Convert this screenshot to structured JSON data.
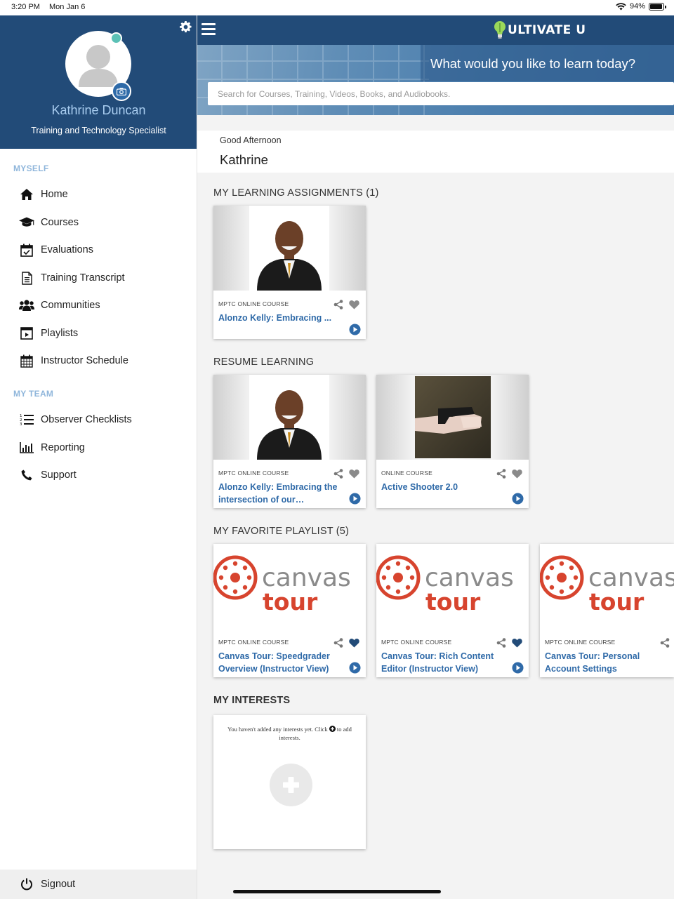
{
  "status_bar": {
    "time": "3:20 PM",
    "date": "Mon Jan 6",
    "battery": "94%"
  },
  "sidebar": {
    "user_name": "Kathrine Duncan",
    "user_title": "Training and Technology Specialist",
    "sections": [
      {
        "label": "MYSELF"
      },
      {
        "label": "MY TEAM"
      }
    ],
    "items": [
      {
        "label": "Home",
        "icon": "home-icon"
      },
      {
        "label": "Courses",
        "icon": "graduation-cap-icon"
      },
      {
        "label": "Evaluations",
        "icon": "calendar-check-icon"
      },
      {
        "label": "Training Transcript",
        "icon": "document-icon"
      },
      {
        "label": "Communities",
        "icon": "users-icon"
      },
      {
        "label": "Playlists",
        "icon": "playlist-icon"
      },
      {
        "label": "Instructor Schedule",
        "icon": "calendar-icon"
      },
      {
        "label": "Observer Checklists",
        "icon": "numbered-list-icon"
      },
      {
        "label": "Reporting",
        "icon": "bar-chart-icon"
      },
      {
        "label": "Support",
        "icon": "phone-icon"
      }
    ],
    "signout_label": "Signout"
  },
  "header": {
    "logo_text": "ULTIVATE U",
    "tagline": "What would you like to learn today?",
    "search_placeholder": "Search for Courses, Training, Videos, Books, and Audiobooks."
  },
  "greeting": {
    "line1": "Good Afternoon",
    "name": "Kathrine"
  },
  "sections": {
    "assignments": "MY LEARNING ASSIGNMENTS (1)",
    "resume": "RESUME LEARNING",
    "favorites": "MY FAVORITE PLAYLIST (5)",
    "interests": "MY INTERESTS"
  },
  "cards": {
    "assignments": [
      {
        "meta": "MPTC ONLINE COURSE",
        "title": "Alonzo Kelly: Embracing ..."
      }
    ],
    "resume": [
      {
        "meta": "MPTC ONLINE COURSE",
        "title": "Alonzo Kelly: Embracing the intersection of our…"
      },
      {
        "meta": "ONLINE COURSE",
        "title": "Active Shooter 2.0"
      }
    ],
    "favorites": [
      {
        "meta": "MPTC ONLINE COURSE",
        "title": "Canvas Tour: Speedgrader Overview (Instructor View)",
        "canvas_word": "canvas",
        "tour_word": "tour"
      },
      {
        "meta": "MPTC ONLINE COURSE",
        "title": "Canvas Tour: Rich Content Editor (Instructor View)",
        "canvas_word": "canvas",
        "tour_word": "tour"
      },
      {
        "meta": "MPTC ONLINE COURSE",
        "title": "Canvas Tour: Personal Account Settings",
        "canvas_word": "canvas",
        "tour_word": "tour"
      }
    ]
  },
  "interests": {
    "empty_message_1": "You haven't added any interests yet. Click",
    "empty_message_2": "to add interests."
  },
  "colors": {
    "brand_navy": "#224b78",
    "link_blue": "#2f6aa8",
    "canvas_red": "#d7442e",
    "canvas_gray": "#8a8a8a",
    "accent_teal": "#5cc1b6"
  }
}
